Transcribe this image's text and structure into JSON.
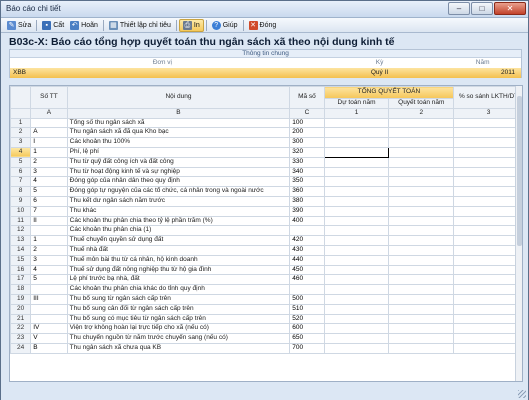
{
  "window": {
    "title": "Báo cáo chi tiết"
  },
  "toolbar": {
    "buttons": [
      {
        "label": "Sửa",
        "icon": "edit-icon",
        "color": "#5b8bd0"
      },
      {
        "label": "Cất",
        "icon": "save-icon",
        "color": "#3a6fb8"
      },
      {
        "label": "Hoãn",
        "icon": "undo-icon",
        "color": "#4a7fc4"
      },
      {
        "label": "Thiết lập chỉ tiêu",
        "icon": "grid-settings-icon",
        "color": "#6a8fb8"
      },
      {
        "label": "In",
        "icon": "printer-icon",
        "color": "#6c7a8e"
      },
      {
        "label": "Giúp",
        "icon": "help-icon",
        "color": "#3b7ed6"
      },
      {
        "label": "Đóng",
        "icon": "close-icon",
        "color": "#d04a2a"
      }
    ]
  },
  "report": {
    "title": "B03c-X: Báo cáo tổng hợp quyết toán thu ngân sách xã theo nội dung kinh tế"
  },
  "info": {
    "caption": "Thông tin chung",
    "headers": {
      "unit": "Đơn vị",
      "period": "Kỳ",
      "year": "Năm"
    },
    "values": {
      "unit": "XBB",
      "period": "Quý II",
      "year": "2011"
    }
  },
  "grid": {
    "headers": {
      "stt": "Số TT",
      "content": "Nội dung",
      "code": "Mã số",
      "group": "TỔNG QUYẾT TOÁN",
      "estimate": "Dự toán năm",
      "settlement": "Quyết toán năm",
      "compare": "% so sánh LKTH/DT"
    },
    "letters": {
      "a": "A",
      "b": "B",
      "c": "C",
      "c1": "1",
      "c2": "2",
      "c3": "3"
    },
    "rows": [
      {
        "n": "1",
        "stt": "",
        "content": "Tổng số thu ngân sách xã",
        "code": "100"
      },
      {
        "n": "2",
        "stt": "A",
        "content": "Thu ngân sách xã đã qua Kho bạc",
        "code": "200"
      },
      {
        "n": "3",
        "stt": "I",
        "content": "Các khoản thu 100%",
        "code": "300"
      },
      {
        "n": "4",
        "stt": "1",
        "content": "Phí, lệ phí",
        "code": "320"
      },
      {
        "n": "5",
        "stt": "2",
        "content": "Thu từ quỹ đất công ích và đất công",
        "code": "330"
      },
      {
        "n": "6",
        "stt": "3",
        "content": "Thu từ hoạt động kinh tế và sự nghiệp",
        "code": "340"
      },
      {
        "n": "7",
        "stt": "4",
        "content": "Đóng góp của nhân dân theo quy định",
        "code": "350"
      },
      {
        "n": "8",
        "stt": "5",
        "content": "Đóng góp tự nguyện của các tổ chức, cá nhân trong và ngoài nước",
        "code": "360"
      },
      {
        "n": "9",
        "stt": "6",
        "content": "Thu kết dư ngân sách năm trước",
        "code": "380"
      },
      {
        "n": "10",
        "stt": "7",
        "content": "Thu khác",
        "code": "390"
      },
      {
        "n": "11",
        "stt": "II",
        "content": "Các khoản thu phân chia theo tỷ lệ phần trăm (%)",
        "code": "400"
      },
      {
        "n": "12",
        "stt": "",
        "content": "Các khoản thu phân chia (1)",
        "code": ""
      },
      {
        "n": "13",
        "stt": "1",
        "content": "Thuế chuyển quyền sử dụng đất",
        "code": "420"
      },
      {
        "n": "14",
        "stt": "2",
        "content": "Thuế nhà đất",
        "code": "430"
      },
      {
        "n": "15",
        "stt": "3",
        "content": "Thuế môn bài thu từ cá nhân, hộ kinh doanh",
        "code": "440"
      },
      {
        "n": "16",
        "stt": "4",
        "content": "Thuế sử dụng đất nông nghiệp thu từ hộ gia đình",
        "code": "450"
      },
      {
        "n": "17",
        "stt": "5",
        "content": "Lệ phí trước bạ nhà, đất",
        "code": "460"
      },
      {
        "n": "18",
        "stt": "",
        "content": "Các khoản thu phân chia khác do tỉnh quy định",
        "code": ""
      },
      {
        "n": "19",
        "stt": "III",
        "content": "Thu bổ sung từ ngân sách cấp trên",
        "code": "500"
      },
      {
        "n": "20",
        "stt": "",
        "content": "Thu bổ sung cân đối từ ngân sách cấp trên",
        "code": "510"
      },
      {
        "n": "21",
        "stt": "",
        "content": "Thu bổ sung có mục tiêu từ ngân sách cấp trên",
        "code": "520"
      },
      {
        "n": "22",
        "stt": "IV",
        "content": "Viện trợ không hoàn lại trực tiếp cho xã (nếu có)",
        "code": "600"
      },
      {
        "n": "23",
        "stt": "V",
        "content": "Thu chuyển nguồn từ năm trước chuyển sang (nếu có)",
        "code": "650"
      },
      {
        "n": "24",
        "stt": "B",
        "content": "Thu ngân sách xã chưa qua KB",
        "code": "700"
      }
    ]
  }
}
